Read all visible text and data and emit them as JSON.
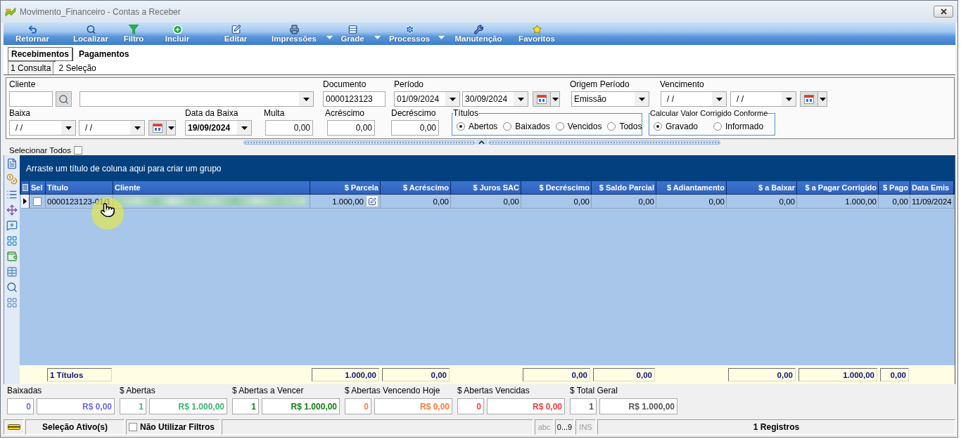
{
  "window": {
    "title": "Movimento_Financeiro - Contas a Receber"
  },
  "toolbar": [
    {
      "kind": "return",
      "label": "Retornar",
      "has_menu": false
    },
    {
      "kind": "search",
      "label": "Localizar",
      "has_menu": false
    },
    {
      "kind": "filter",
      "label": "Filtro",
      "has_menu": false
    },
    {
      "kind": "add",
      "label": "Incluir",
      "has_menu": false
    },
    {
      "kind": "edit",
      "label": "Editar",
      "has_menu": false
    },
    {
      "kind": "print",
      "label": "Impressões",
      "has_menu": true
    },
    {
      "kind": "grid",
      "label": "Grade",
      "has_menu": true
    },
    {
      "kind": "process",
      "label": "Processos",
      "has_menu": true
    },
    {
      "kind": "maintenance",
      "label": "Manutenção",
      "has_menu": false
    },
    {
      "kind": "favorites",
      "label": "Favoritos",
      "has_menu": false
    }
  ],
  "tabs": [
    {
      "label": "Recebimentos",
      "selected": true
    },
    {
      "label": "Pagamentos",
      "selected": false
    }
  ],
  "subtabs": [
    {
      "label": "1 Consulta",
      "selected": true
    },
    {
      "label": "2 Seleção",
      "selected": false
    }
  ],
  "filters": {
    "cliente": {
      "label": "Cliente"
    },
    "documento": {
      "label": "Documento",
      "value": "0000123123"
    },
    "periodo": {
      "label": "Período",
      "from": "01/09/2024",
      "to": "30/09/2024"
    },
    "origem_periodo": {
      "label": "Origem Período",
      "value": "Emissão"
    },
    "vencimento": {
      "label": "Vencimento",
      "from": "/ /",
      "to": "/ /"
    },
    "baixa": {
      "label": "Baixa",
      "from": "/ /",
      "to": "/ /"
    },
    "data_da_baixa": {
      "label": "Data da Baixa",
      "value": "19/09/2024"
    },
    "multa": {
      "label": "Multa",
      "value": "0,00"
    },
    "acrescimo": {
      "label": "Acréscimo",
      "value": "0,00"
    },
    "decrescimo": {
      "label": "Decréscimo",
      "value": "0,00"
    },
    "titulos": {
      "legend": "Títulos",
      "options": [
        {
          "label": "Abertos",
          "selected": true
        },
        {
          "label": "Baixados",
          "selected": false
        },
        {
          "label": "Vencidos",
          "selected": false
        },
        {
          "label": "Todos",
          "selected": false
        }
      ]
    },
    "calcular": {
      "legend": "Calcular Valor Corrigido Conforme",
      "options": [
        {
          "label": "Gravado",
          "selected": true
        },
        {
          "label": "Informado",
          "selected": false
        }
      ]
    }
  },
  "select_all": {
    "label": "Selecionar Todos",
    "checked": false
  },
  "grid": {
    "group_hint": "Arraste um título de coluna aqui para criar um grupo",
    "columns": [
      {
        "label": "Sel",
        "kind": "text"
      },
      {
        "label": "Título",
        "kind": "text"
      },
      {
        "label": "Cliente",
        "kind": "text"
      },
      {
        "label": "$ Parcela",
        "kind": "money"
      },
      {
        "label": "$ Acréscimo",
        "kind": "money"
      },
      {
        "label": "$ Juros SAC",
        "kind": "money"
      },
      {
        "label": "$ Decréscimo",
        "kind": "money"
      },
      {
        "label": "$ Saldo Parcial",
        "kind": "money"
      },
      {
        "label": "$ Adiantamento",
        "kind": "money"
      },
      {
        "label": "$ a Baixar",
        "kind": "money"
      },
      {
        "label": "$ a Pagar Corrigido",
        "kind": "money"
      },
      {
        "label": "$ Pago",
        "kind": "money"
      },
      {
        "label": "Data Emis",
        "kind": "text"
      }
    ],
    "rows": [
      {
        "selected": true,
        "cells": [
          {
            "kind": "check",
            "checked": false
          },
          {
            "kind": "text",
            "text": "0000123123-01/1"
          },
          {
            "kind": "blurred"
          },
          {
            "kind": "money_edit",
            "text": "1.000,00"
          },
          {
            "kind": "money",
            "text": "0,00"
          },
          {
            "kind": "money",
            "text": "0,00"
          },
          {
            "kind": "money",
            "text": "0,00"
          },
          {
            "kind": "money",
            "text": "0,00"
          },
          {
            "kind": "money",
            "text": "0,00"
          },
          {
            "kind": "money",
            "text": "0,00"
          },
          {
            "kind": "money",
            "text": "1.000,00"
          },
          {
            "kind": "money",
            "text": "0,00"
          },
          {
            "kind": "text",
            "text": "11/09/2024"
          }
        ]
      }
    ],
    "totals": {
      "cells": [
        {
          "kind": "blank"
        },
        {
          "kind": "count",
          "text": "1 Títulos"
        },
        {
          "kind": "blank"
        },
        {
          "kind": "sum",
          "text": "1.000,00"
        },
        {
          "kind": "sum",
          "text": "0,00"
        },
        {
          "kind": "blank"
        },
        {
          "kind": "sum",
          "text": "0,00"
        },
        {
          "kind": "sum",
          "text": "0,00"
        },
        {
          "kind": "blank"
        },
        {
          "kind": "sum",
          "text": "0,00"
        },
        {
          "kind": "sum",
          "text": "1.000,00"
        },
        {
          "kind": "sum",
          "text": "0,00"
        },
        {
          "kind": "blank"
        }
      ]
    }
  },
  "summary": [
    {
      "label": "Baixadas",
      "count": "0",
      "amount": "R$ 0,00",
      "color": "#6a6af0"
    },
    {
      "label": "$ Abertas",
      "count": "1",
      "amount": "R$ 1.000,00",
      "color": "#3cb371"
    },
    {
      "label": "$ Abertas a Vencer",
      "count": "1",
      "amount": "R$ 1.000,00",
      "color": "#128012"
    },
    {
      "label": "$ Abertas Vencendo Hoje",
      "count": "0",
      "amount": "R$ 0,00",
      "color": "#ff7a3c"
    },
    {
      "label": "$ Abertas Vencidas",
      "count": "0",
      "amount": "R$ 0,00",
      "color": "#ff3b3b"
    },
    {
      "label": "$ Total Geral",
      "count": "1",
      "amount": "R$ 1.000,00",
      "color": "#555555"
    }
  ],
  "status_bar": {
    "selection": "Seleção Ativo(s)",
    "no_filters": {
      "label": "Não Utilizar Filtros",
      "checked": false
    },
    "indicators": [
      {
        "label": "abc",
        "active": false
      },
      {
        "label": "0...9",
        "active": true
      },
      {
        "label": "INS",
        "active": false
      }
    ],
    "records": "1 Registros"
  }
}
